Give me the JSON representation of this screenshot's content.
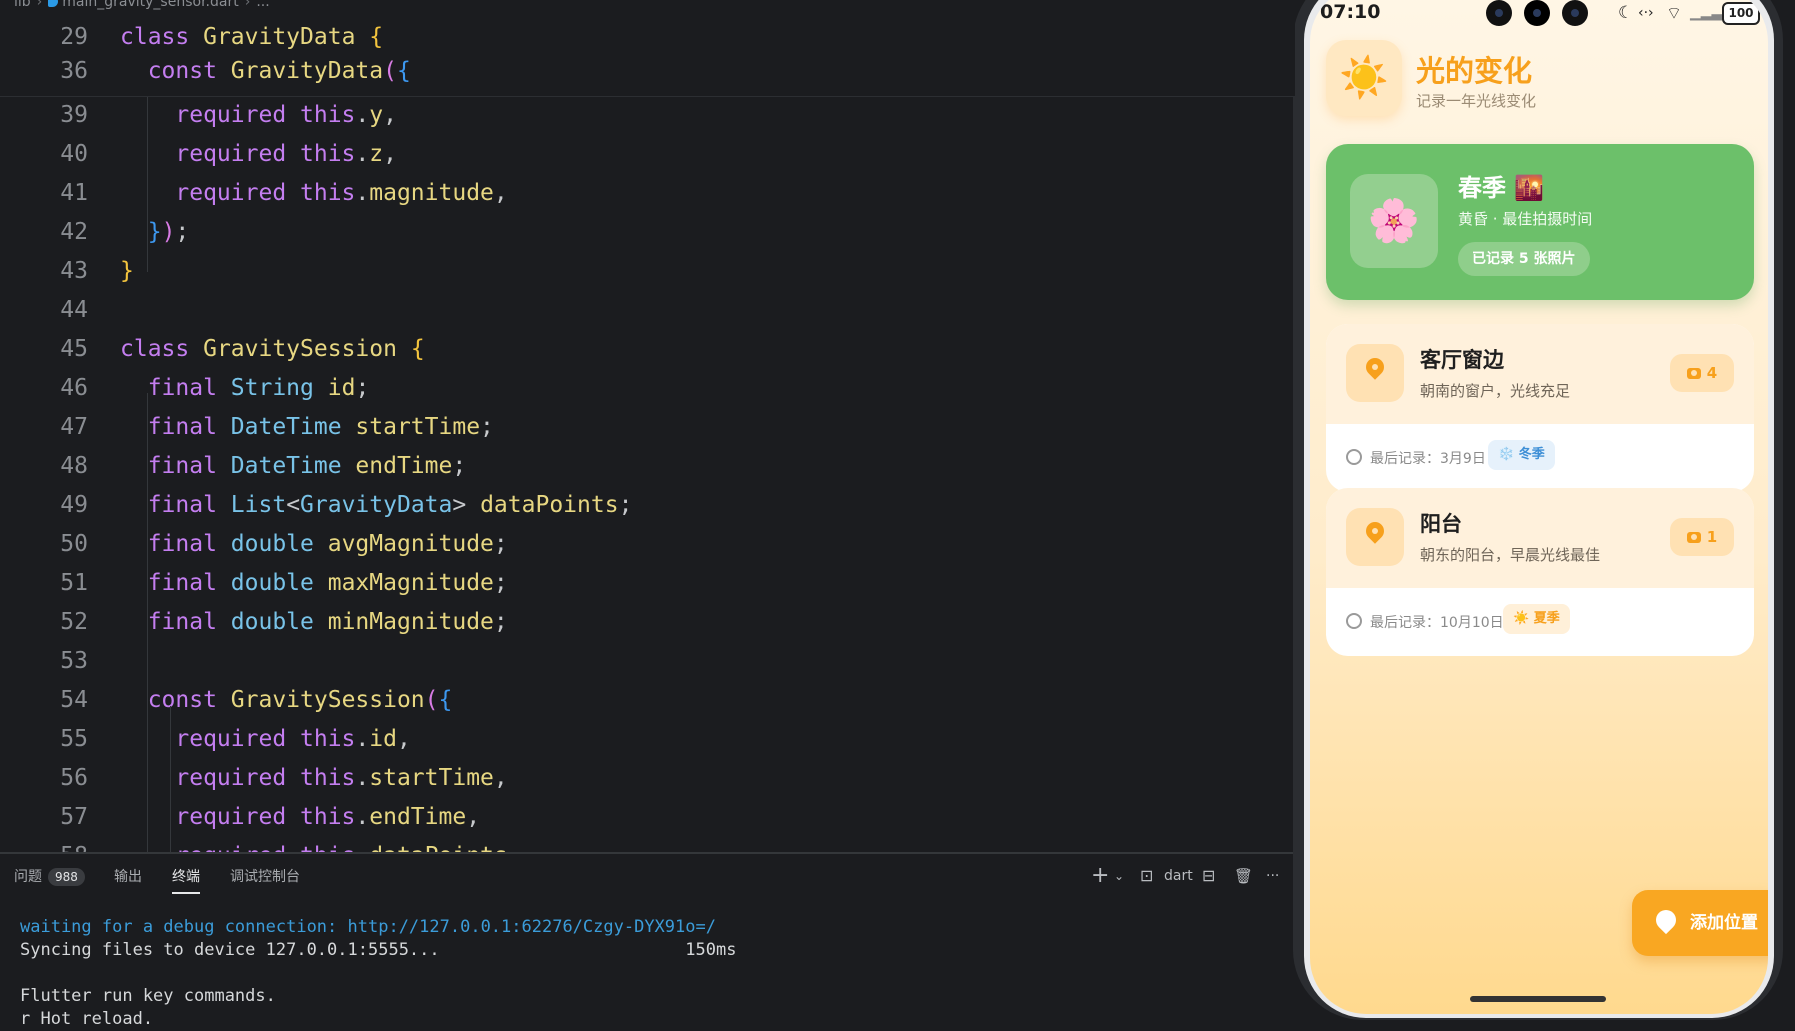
{
  "editor": {
    "breadcrumb": [
      "lib",
      "main_gravity_sensor.dart",
      "..."
    ],
    "sticky": [
      {
        "ln": "29",
        "tokens": [
          [
            "kw",
            "class "
          ],
          [
            "cls",
            "GravityData "
          ],
          [
            "br1",
            "{"
          ]
        ]
      },
      {
        "ln": "36",
        "tokens": [
          [
            "pun",
            "  "
          ],
          [
            "kw",
            "const "
          ],
          [
            "cls",
            "GravityData"
          ],
          [
            "br2",
            "("
          ],
          [
            "br3",
            "{"
          ]
        ]
      }
    ],
    "lines": [
      {
        "ln": "39",
        "tokens": [
          [
            "pun",
            "    "
          ],
          [
            "kw",
            "required "
          ],
          [
            "kw",
            "this"
          ],
          [
            "pun",
            "."
          ],
          [
            "prm",
            "y"
          ],
          [
            "pun",
            ","
          ]
        ]
      },
      {
        "ln": "40",
        "tokens": [
          [
            "pun",
            "    "
          ],
          [
            "kw",
            "required "
          ],
          [
            "kw",
            "this"
          ],
          [
            "pun",
            "."
          ],
          [
            "prm",
            "z"
          ],
          [
            "pun",
            ","
          ]
        ]
      },
      {
        "ln": "41",
        "tokens": [
          [
            "pun",
            "    "
          ],
          [
            "kw",
            "required "
          ],
          [
            "kw",
            "this"
          ],
          [
            "pun",
            "."
          ],
          [
            "prm",
            "magnitude"
          ],
          [
            "pun",
            ","
          ]
        ]
      },
      {
        "ln": "42",
        "tokens": [
          [
            "pun",
            "  "
          ],
          [
            "br3",
            "}"
          ],
          [
            "br2",
            ")"
          ],
          [
            "pun",
            ";"
          ]
        ]
      },
      {
        "ln": "43",
        "tokens": [
          [
            "br1",
            "}"
          ]
        ]
      },
      {
        "ln": "44",
        "tokens": []
      },
      {
        "ln": "45",
        "tokens": [
          [
            "kw",
            "class "
          ],
          [
            "cls",
            "GravitySession "
          ],
          [
            "br1",
            "{"
          ]
        ]
      },
      {
        "ln": "46",
        "tokens": [
          [
            "pun",
            "  "
          ],
          [
            "kw",
            "final "
          ],
          [
            "ty",
            "String "
          ],
          [
            "prm",
            "id"
          ],
          [
            "pun",
            ";"
          ]
        ]
      },
      {
        "ln": "47",
        "tokens": [
          [
            "pun",
            "  "
          ],
          [
            "kw",
            "final "
          ],
          [
            "ty",
            "DateTime "
          ],
          [
            "prm",
            "startTime"
          ],
          [
            "pun",
            ";"
          ]
        ]
      },
      {
        "ln": "48",
        "tokens": [
          [
            "pun",
            "  "
          ],
          [
            "kw",
            "final "
          ],
          [
            "ty",
            "DateTime "
          ],
          [
            "prm",
            "endTime"
          ],
          [
            "pun",
            ";"
          ]
        ]
      },
      {
        "ln": "49",
        "tokens": [
          [
            "pun",
            "  "
          ],
          [
            "kw",
            "final "
          ],
          [
            "ty",
            "List"
          ],
          [
            "pun",
            "<"
          ],
          [
            "ty",
            "GravityData"
          ],
          [
            "pun",
            "> "
          ],
          [
            "prm",
            "dataPoints"
          ],
          [
            "pun",
            ";"
          ]
        ]
      },
      {
        "ln": "50",
        "tokens": [
          [
            "pun",
            "  "
          ],
          [
            "kw",
            "final "
          ],
          [
            "ty",
            "double "
          ],
          [
            "prm",
            "avgMagnitude"
          ],
          [
            "pun",
            ";"
          ]
        ]
      },
      {
        "ln": "51",
        "tokens": [
          [
            "pun",
            "  "
          ],
          [
            "kw",
            "final "
          ],
          [
            "ty",
            "double "
          ],
          [
            "prm",
            "maxMagnitude"
          ],
          [
            "pun",
            ";"
          ]
        ]
      },
      {
        "ln": "52",
        "tokens": [
          [
            "pun",
            "  "
          ],
          [
            "kw",
            "final "
          ],
          [
            "ty",
            "double "
          ],
          [
            "prm",
            "minMagnitude"
          ],
          [
            "pun",
            ";"
          ]
        ]
      },
      {
        "ln": "53",
        "tokens": []
      },
      {
        "ln": "54",
        "tokens": [
          [
            "pun",
            "  "
          ],
          [
            "kw",
            "const "
          ],
          [
            "cls",
            "GravitySession"
          ],
          [
            "br2",
            "("
          ],
          [
            "br3",
            "{"
          ]
        ]
      },
      {
        "ln": "55",
        "tokens": [
          [
            "pun",
            "    "
          ],
          [
            "kw",
            "required "
          ],
          [
            "kw",
            "this"
          ],
          [
            "pun",
            "."
          ],
          [
            "prm",
            "id"
          ],
          [
            "pun",
            ","
          ]
        ]
      },
      {
        "ln": "56",
        "tokens": [
          [
            "pun",
            "    "
          ],
          [
            "kw",
            "required "
          ],
          [
            "kw",
            "this"
          ],
          [
            "pun",
            "."
          ],
          [
            "prm",
            "startTime"
          ],
          [
            "pun",
            ","
          ]
        ]
      },
      {
        "ln": "57",
        "tokens": [
          [
            "pun",
            "    "
          ],
          [
            "kw",
            "required "
          ],
          [
            "kw",
            "this"
          ],
          [
            "pun",
            "."
          ],
          [
            "prm",
            "endTime"
          ],
          [
            "pun",
            ","
          ]
        ]
      },
      {
        "ln": "58",
        "tokens": [
          [
            "pun",
            "    "
          ],
          [
            "kw",
            "required "
          ],
          [
            "kw",
            "this"
          ],
          [
            "pun",
            "."
          ],
          [
            "prm",
            "dataPoints"
          ],
          [
            "pun",
            ","
          ]
        ]
      }
    ]
  },
  "panel": {
    "tabs": [
      {
        "label": "问题",
        "badge": "988"
      },
      {
        "label": "输出"
      },
      {
        "label": "终端",
        "active": true
      },
      {
        "label": "调试控制台"
      }
    ],
    "toolbar": {
      "add": "+",
      "chevron": "⌄",
      "shell_icon": "⊡",
      "shell": "dart",
      "split": "⊟",
      "trash": "🗑",
      "more": "···"
    },
    "terminal": [
      {
        "text": "waiting for a debug connection: http://127.0.0.1:62276/Czgy-DYX91o=/",
        "blue": true
      },
      {
        "text": "Syncing files to device 127.0.0.1:5555...                        150ms"
      },
      {
        "text": ""
      },
      {
        "text": "Flutter run key commands."
      },
      {
        "text": "r Hot reload."
      }
    ]
  },
  "phone": {
    "time": "07:10",
    "battery": "100",
    "app": {
      "title": "光的变化",
      "subtitle": "记录一年光线变化",
      "sun_icon": "☀️"
    },
    "season_card": {
      "icon": "🌸",
      "name": "春季 🌇",
      "tip": "黄昏 · 最佳拍摄时间",
      "count": "已记录 5 张照片"
    },
    "locations": [
      {
        "name": "客厅窗边",
        "desc": "朝南的窗户，光线充足",
        "photos": "4",
        "last": "最后记录：3月9日",
        "season": "❄️ 冬季",
        "season_bg": "#e6f1fb",
        "season_fg": "#3e8fd6"
      },
      {
        "name": "阳台",
        "desc": "朝东的阳台，早晨光线最佳",
        "photos": "1",
        "last": "最后记录：10月10日",
        "season": "☀️ 夏季",
        "season_bg": "#fff0d9",
        "season_fg": "#f7a01c"
      }
    ],
    "add_button": "添加位置"
  }
}
